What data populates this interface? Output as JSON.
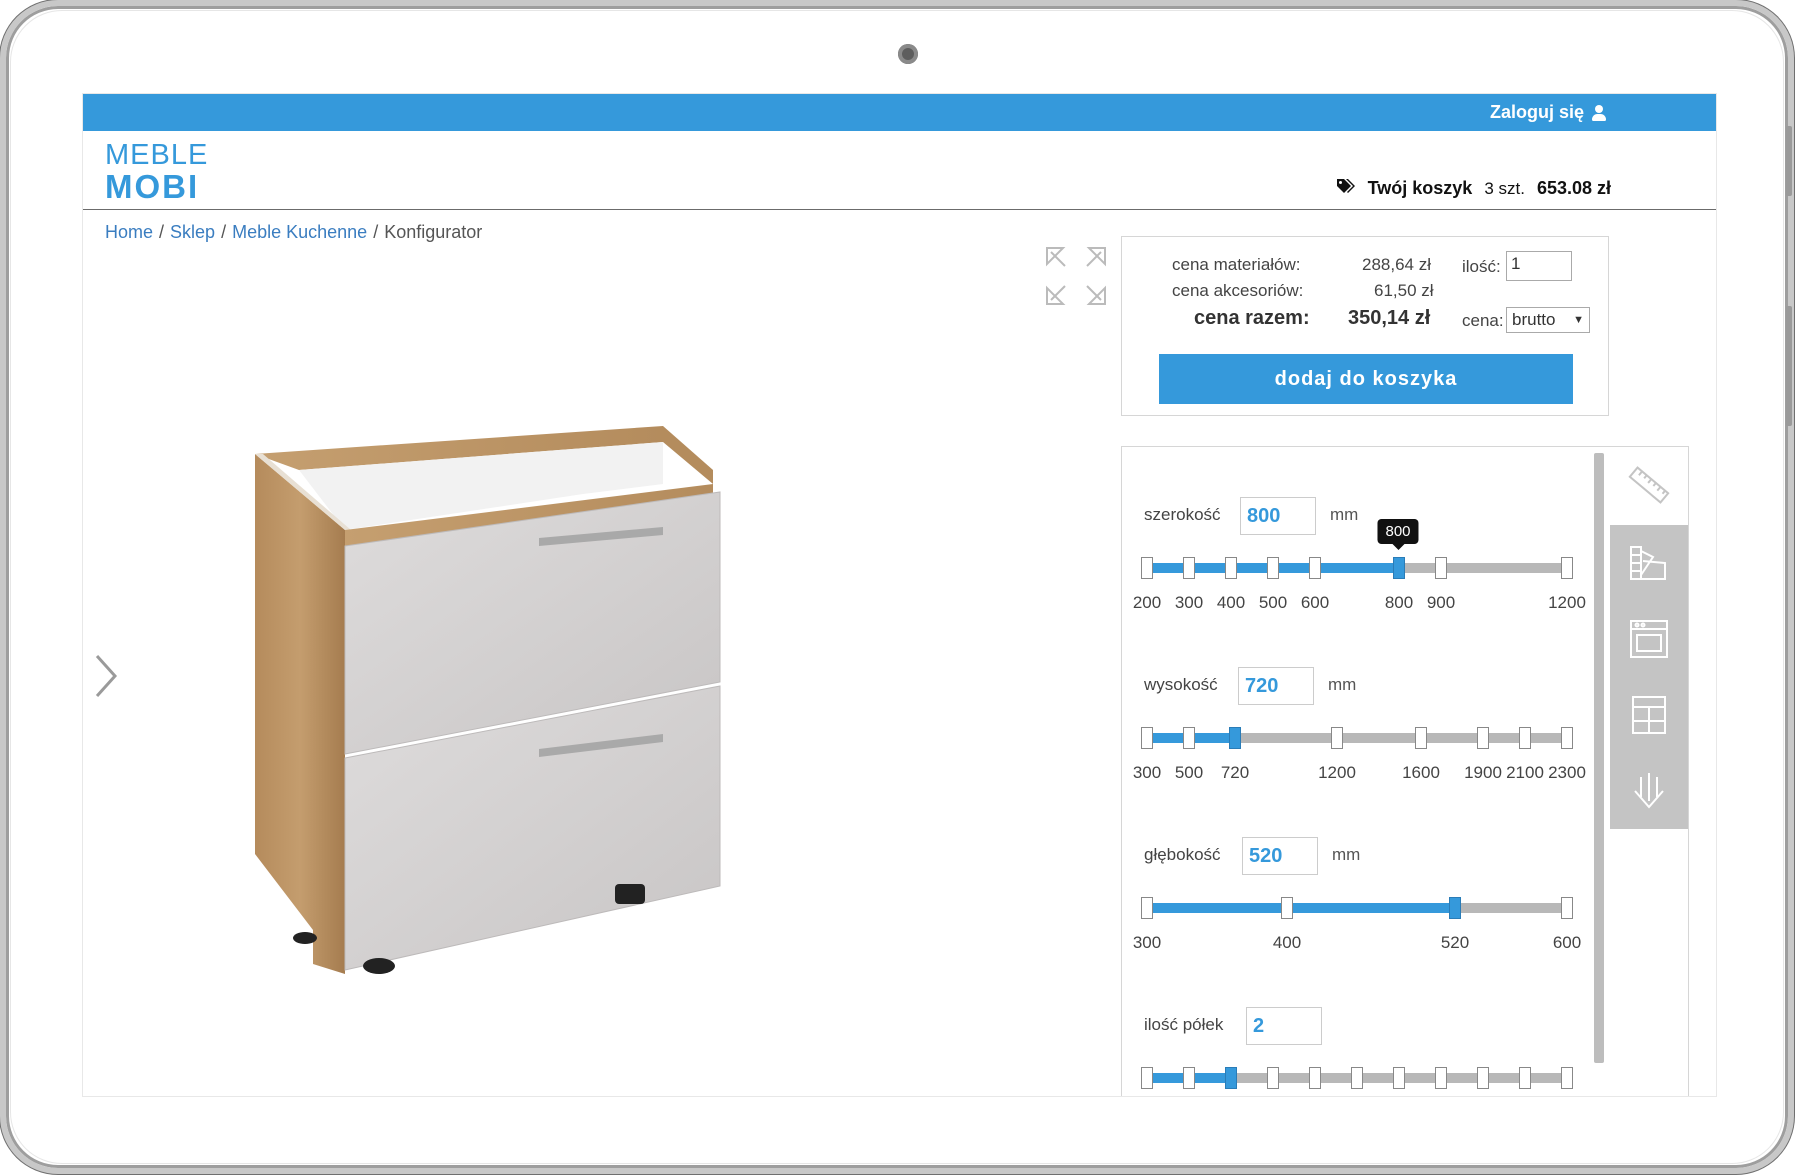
{
  "topbar": {
    "login_label": "Zaloguj się",
    "icon": "user-icon"
  },
  "logo": {
    "top": "MEBLE",
    "bottom": "MOBI"
  },
  "cart": {
    "label": "Twój koszyk",
    "count": "3 szt.",
    "total": "653.08 zł",
    "icon": "tag-icon"
  },
  "breadcrumb": [
    {
      "label": "Home"
    },
    {
      "label": "Sklep"
    },
    {
      "label": "Meble Kuchenne"
    },
    {
      "label": "Konfigurator"
    }
  ],
  "price": {
    "materials_label": "cena materiałów:",
    "materials_value": "288,64 zł",
    "accessories_label": "cena akcesoriów:",
    "accessories_value": "61,50 zł",
    "total_label": "cena razem:",
    "total_value": "350,14 zł",
    "qty_label": "ilość:",
    "qty_value": "1",
    "cena_label": "cena:",
    "cena_value": "brutto",
    "add_button": "dodaj do koszyka"
  },
  "config": {
    "szerokosc": {
      "label": "szerokość",
      "value": "800",
      "unit": "mm",
      "tooltip": "800",
      "ticks": [
        "200",
        "300",
        "400",
        "500",
        "600",
        "800",
        "900",
        "1200"
      ]
    },
    "wysokosc": {
      "label": "wysokość",
      "value": "720",
      "unit": "mm",
      "ticks": [
        "300",
        "500",
        "720",
        "1200",
        "1600",
        "1900",
        "2100",
        "2300"
      ]
    },
    "glebokosc": {
      "label": "głębokość",
      "value": "520",
      "unit": "mm",
      "ticks": [
        "300",
        "400",
        "520",
        "600"
      ]
    },
    "polki": {
      "label": "ilość półek",
      "value": "2"
    }
  },
  "colors": {
    "accent": "#3599db",
    "track": "#b8b8b8",
    "tab_bg": "#c4c4c4"
  }
}
